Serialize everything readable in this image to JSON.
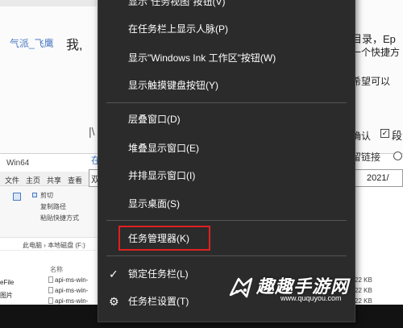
{
  "forum": {
    "username": "气派_飞鹰",
    "text_colon": "我,",
    "right_text_1": "目录，Ep",
    "right_text_2": "一个快捷方",
    "right_text_3": "希望可以",
    "checkbox_label_1": "确认",
    "checkbox_label_2": "段",
    "left_pipe": "|\\",
    "left_link": "在",
    "form_label": "留链接",
    "left_box_text": "双",
    "date_value": "2021/"
  },
  "explorer": {
    "window_title": "Win64",
    "tabs": [
      "文件",
      "主页",
      "共享",
      "查看"
    ],
    "ribbon_items": [
      "剪切",
      "复制路径",
      "粘贴快捷方式"
    ],
    "address_parts": [
      "此电脑",
      "本地磁盘 (F:)"
    ],
    "column_header": "名称",
    "sidebar": [
      "eFile",
      "图片"
    ],
    "files": [
      "api-ms-win-",
      "api-ms-win-",
      "api-ms-win-",
      "api-ms-win-"
    ],
    "sizes": [
      "22 KB",
      "22 KB",
      "22 KB",
      "22 KB"
    ]
  },
  "context_menu": {
    "items": [
      {
        "label": "显示\"任务视图\"按钮(V)",
        "icon": ""
      },
      {
        "label": "在任务栏上显示人脉(P)",
        "icon": ""
      },
      {
        "label": "显示\"Windows Ink 工作区\"按钮(W)",
        "icon": ""
      },
      {
        "label": "显示触摸键盘按钮(Y)",
        "icon": ""
      },
      {
        "label": "层叠窗口(D)",
        "icon": ""
      },
      {
        "label": "堆叠显示窗口(E)",
        "icon": ""
      },
      {
        "label": "并排显示窗口(I)",
        "icon": ""
      },
      {
        "label": "显示桌面(S)",
        "icon": ""
      },
      {
        "label": "任务管理器(K)",
        "icon": "",
        "highlighted": true
      },
      {
        "label": "锁定任务栏(L)",
        "icon": "check-icon"
      },
      {
        "label": "任务栏设置(T)",
        "icon": "gear-icon"
      }
    ]
  },
  "watermark": {
    "title": "趣趣手游网",
    "url": "www.ququyou.com"
  },
  "colors": {
    "menu_bg": "#2b2b2b",
    "menu_text": "#ffffff",
    "highlight": "#e02020",
    "link": "#4a79c4"
  }
}
